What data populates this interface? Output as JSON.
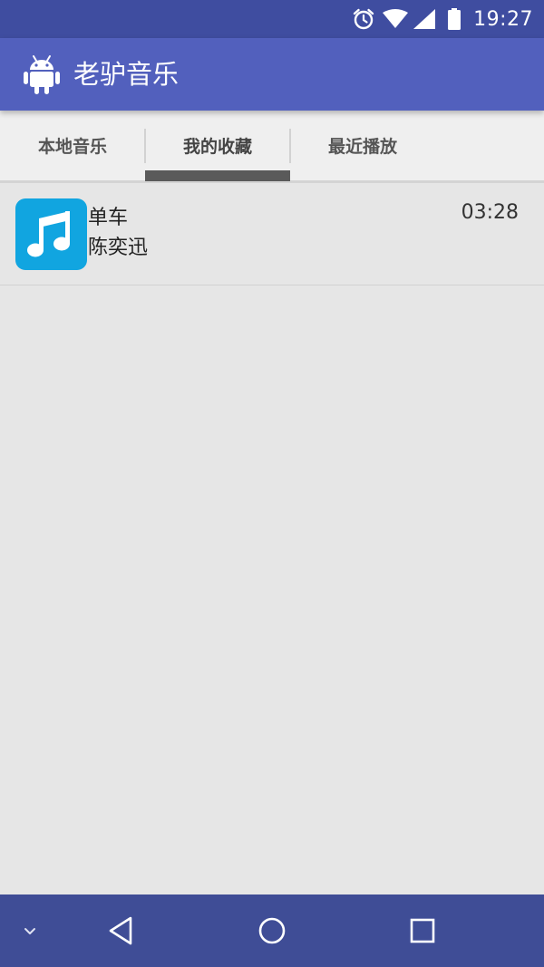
{
  "status_bar": {
    "time": "19:27",
    "icons": [
      "alarm-icon",
      "wifi-icon",
      "cell-signal-icon",
      "battery-icon"
    ]
  },
  "app_bar": {
    "title": "老驴音乐",
    "icon": "android-icon"
  },
  "tabs": [
    {
      "label": "本地音乐",
      "selected": false
    },
    {
      "label": "我的收藏",
      "selected": true
    },
    {
      "label": "最近播放",
      "selected": false
    }
  ],
  "songs": [
    {
      "title": "单车",
      "artist": "陈奕迅",
      "duration": "03:28",
      "icon": "music-note-icon"
    }
  ],
  "nav_bar": {
    "icons": [
      "chevron-down-icon",
      "back-icon",
      "home-icon",
      "recents-icon"
    ]
  },
  "colors": {
    "status_bar": "#3f4da0",
    "app_bar": "#5260bd",
    "nav_bar": "#3f4d96",
    "tab_indicator": "#5a5a5a",
    "song_cover": "#11a5e0",
    "background": "#e6e6e6"
  }
}
